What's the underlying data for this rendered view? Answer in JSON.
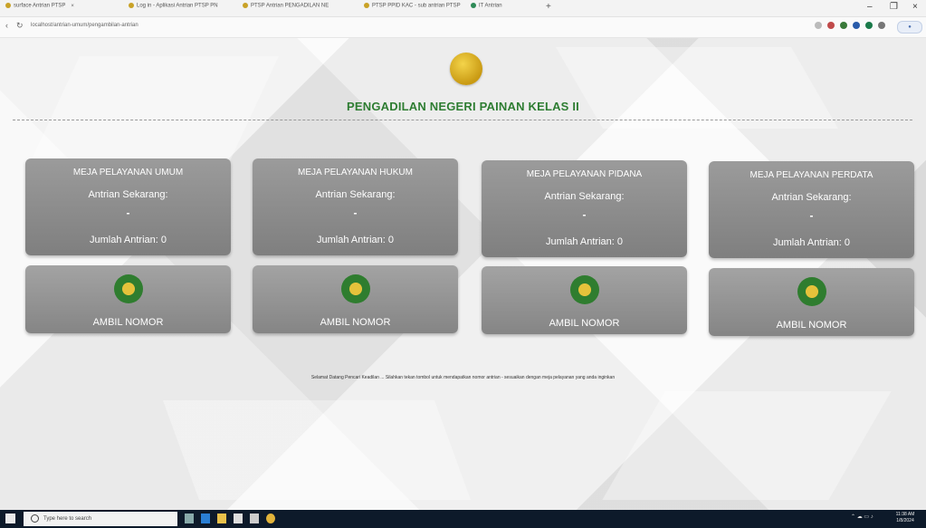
{
  "browser": {
    "tabs": [
      {
        "label": "surface Antrian PTSP"
      },
      {
        "label": "Log in - Aplikasi Antrian PTSP PN"
      },
      {
        "label": "PTSP Antrian PENGADILAN NE"
      },
      {
        "label": "PTSP PPID KAC - sub antrian PTSP"
      },
      {
        "label": "IT Antrian"
      }
    ],
    "url": "localhost/antrian-umum/pengambilan-antrian"
  },
  "header": {
    "title": "PENGADILAN NEGERI PAINAN KELAS II"
  },
  "services": [
    {
      "name": "MEJA PELAYANAN UMUM",
      "current_label": "Antrian Sekarang:",
      "current_value": "-",
      "count_label": "Jumlah Antrian: 0",
      "button_label": "AMBIL NOMOR"
    },
    {
      "name": "MEJA PELAYANAN HUKUM",
      "current_label": "Antrian Sekarang:",
      "current_value": "-",
      "count_label": "Jumlah Antrian: 0",
      "button_label": "AMBIL NOMOR"
    },
    {
      "name": "MEJA PELAYANAN PIDANA",
      "current_label": "Antrian Sekarang:",
      "current_value": "-",
      "count_label": "Jumlah Antrian: 0",
      "button_label": "AMBIL NOMOR"
    },
    {
      "name": "MEJA PELAYANAN PERDATA",
      "current_label": "Antrian Sekarang:",
      "current_value": "-",
      "count_label": "Jumlah Antrian: 0",
      "button_label": "AMBIL NOMOR"
    }
  ],
  "marquee": "Selamat Datang Pencari Keadilan ... Silahkan tekan tombol untuk mendapatkan nomor antrian - sesuaikan dengan meja pelayanan yang anda inginkan",
  "taskbar": {
    "search_placeholder": "Type here to search",
    "time": "11:38 AM",
    "date": "1/8/2024"
  },
  "colors": {
    "title": "#2e7d32",
    "card": "#8c8c8c",
    "emblem": "#2f7d2f"
  }
}
